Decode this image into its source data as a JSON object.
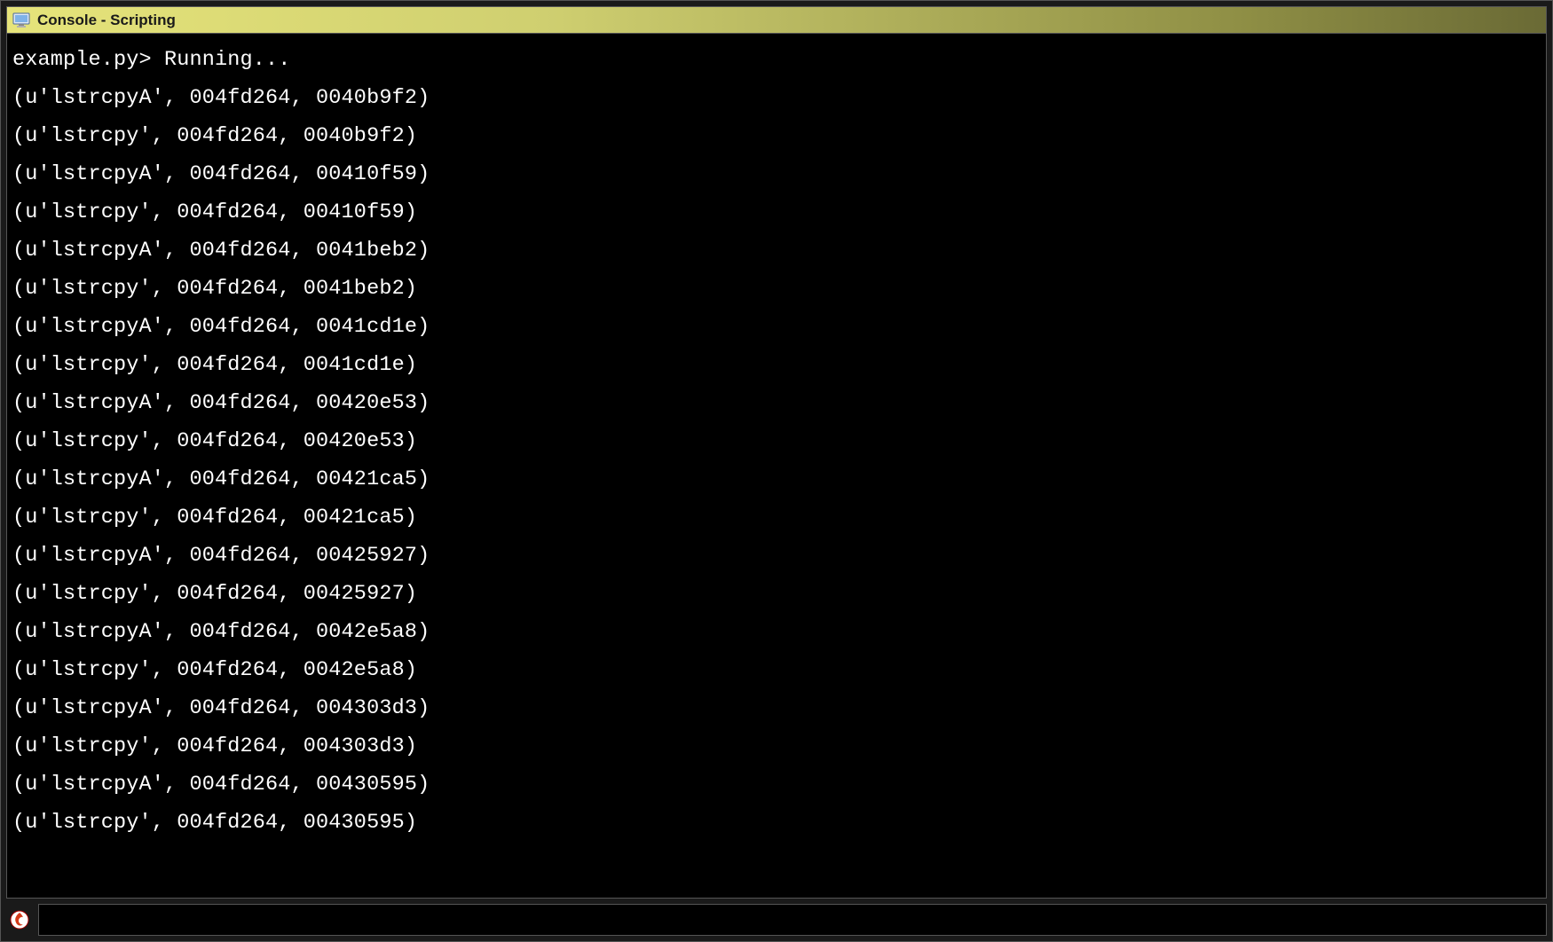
{
  "titlebar": {
    "title": "Console - Scripting",
    "icon": "console-monitor-icon"
  },
  "console": {
    "prompt_line": "example.py> Running...",
    "lines": [
      "(u'lstrcpyA', 004fd264, 0040b9f2)",
      "(u'lstrcpy', 004fd264, 0040b9f2)",
      "(u'lstrcpyA', 004fd264, 00410f59)",
      "(u'lstrcpy', 004fd264, 00410f59)",
      "(u'lstrcpyA', 004fd264, 0041beb2)",
      "(u'lstrcpy', 004fd264, 0041beb2)",
      "(u'lstrcpyA', 004fd264, 0041cd1e)",
      "(u'lstrcpy', 004fd264, 0041cd1e)",
      "(u'lstrcpyA', 004fd264, 00420e53)",
      "(u'lstrcpy', 004fd264, 00420e53)",
      "(u'lstrcpyA', 004fd264, 00421ca5)",
      "(u'lstrcpy', 004fd264, 00421ca5)",
      "(u'lstrcpyA', 004fd264, 00425927)",
      "(u'lstrcpy', 004fd264, 00425927)",
      "(u'lstrcpyA', 004fd264, 0042e5a8)",
      "(u'lstrcpy', 004fd264, 0042e5a8)",
      "(u'lstrcpyA', 004fd264, 004303d3)",
      "(u'lstrcpy', 004fd264, 004303d3)",
      "(u'lstrcpyA', 004fd264, 00430595)",
      "(u'lstrcpy', 004fd264, 00430595)"
    ]
  },
  "command_input": {
    "value": "",
    "placeholder": ""
  },
  "colors": {
    "titlebar_gradient_start": "#e6e47a",
    "titlebar_gradient_end": "#6a6a35",
    "console_bg": "#000000",
    "console_fg": "#ffffff",
    "border": "#555555"
  }
}
